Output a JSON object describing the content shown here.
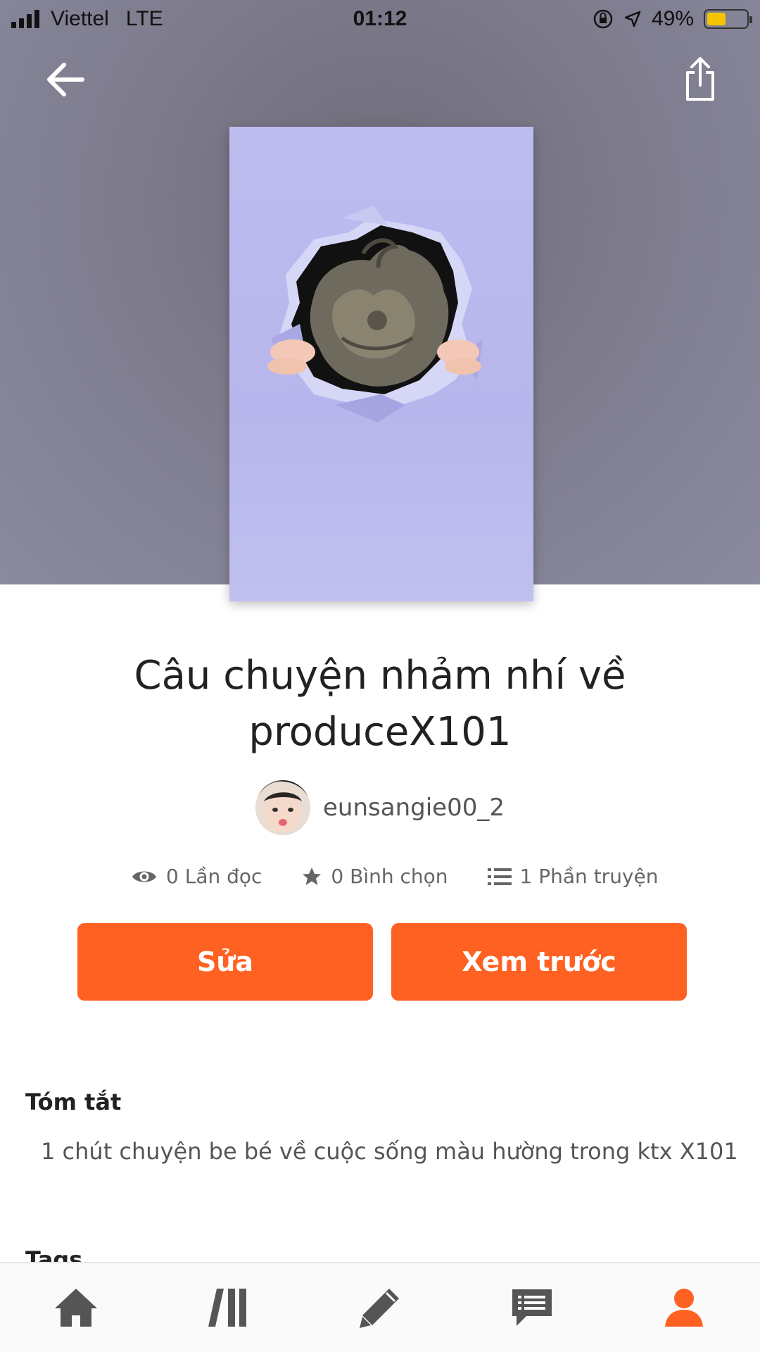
{
  "status_bar": {
    "carrier": "Viettel",
    "network": "LTE",
    "time": "01:12",
    "battery": "49%",
    "battery_level": 0.49,
    "battery_color": "#f5c400"
  },
  "header": {
    "back_icon": "arrow-left-icon",
    "share_icon": "share-icon"
  },
  "story": {
    "title_line1": "Câu chuyện nhảm nhí về",
    "title_line2": "produceX101",
    "author": "eunsangie00_2",
    "stats": {
      "reads": "0 Lần đọc",
      "votes": "0 Bình chọn",
      "parts": "1 Phần truyện"
    }
  },
  "actions": {
    "edit_label": "Sửa",
    "preview_label": "Xem trước",
    "accent_color": "#ff6122"
  },
  "summary": {
    "heading": "Tóm tắt",
    "text": "1 chút chuyện be bé về cuộc sống màu hường trong ktx X101"
  },
  "tags": {
    "heading": "Tags"
  },
  "bottom_nav": {
    "items": [
      "home-icon",
      "library-icon",
      "write-icon",
      "messages-icon",
      "profile-icon"
    ],
    "active": "profile-icon",
    "active_color": "#ff6122",
    "inactive_color": "#555555"
  }
}
